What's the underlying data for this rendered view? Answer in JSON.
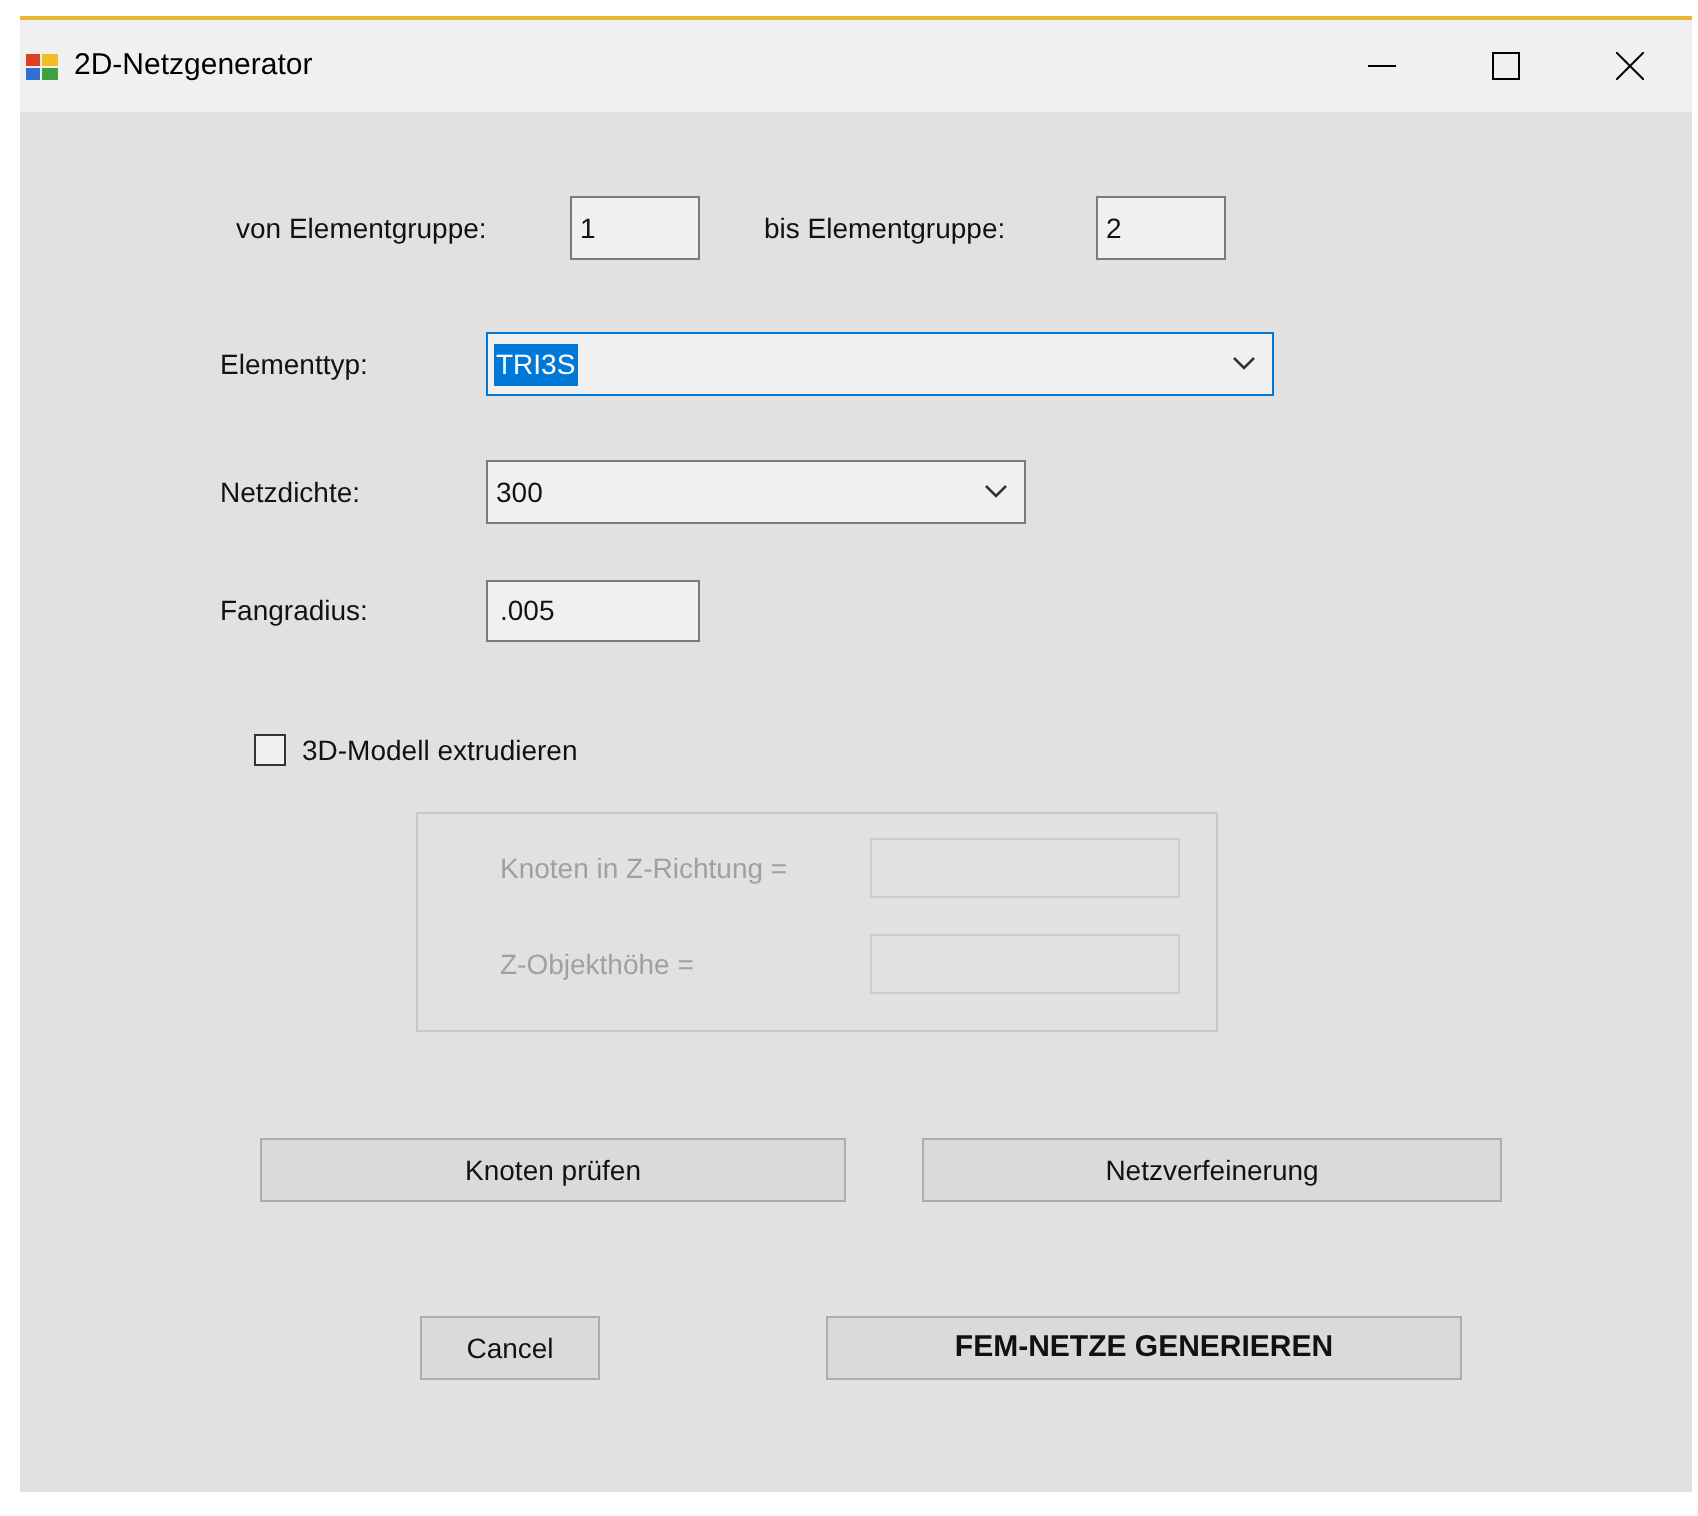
{
  "window": {
    "title": "2D-Netzgenerator"
  },
  "group_range": [
    {
      "label": "von Elementgruppe:",
      "value": "1"
    },
    {
      "label": "bis Elementgruppe:",
      "value": "2"
    }
  ],
  "element_type": {
    "label": "Elementtyp:",
    "value": "TRI3S",
    "focused": true
  },
  "mesh_density": {
    "label": "Netzdichte:",
    "value": "300",
    "focused": false
  },
  "snap_radius": {
    "label": "Fangradius:",
    "value": ".005"
  },
  "extrude": {
    "label": "3D-Modell extrudieren",
    "checked": false
  },
  "extrude_fields": [
    {
      "label": "Knoten in Z-Richtung =",
      "disabled": true
    },
    {
      "label": "Z-Objekthöhe =",
      "disabled": true
    }
  ],
  "tool_buttons": [
    {
      "label": "Knoten prüfen",
      "bold": false
    },
    {
      "label": "Netzverfeinerung",
      "bold": false
    }
  ],
  "dialog_buttons": [
    {
      "label": "Cancel",
      "bold": false
    },
    {
      "label": "FEM-NETZE GENERIEREN",
      "bold": true
    }
  ]
}
